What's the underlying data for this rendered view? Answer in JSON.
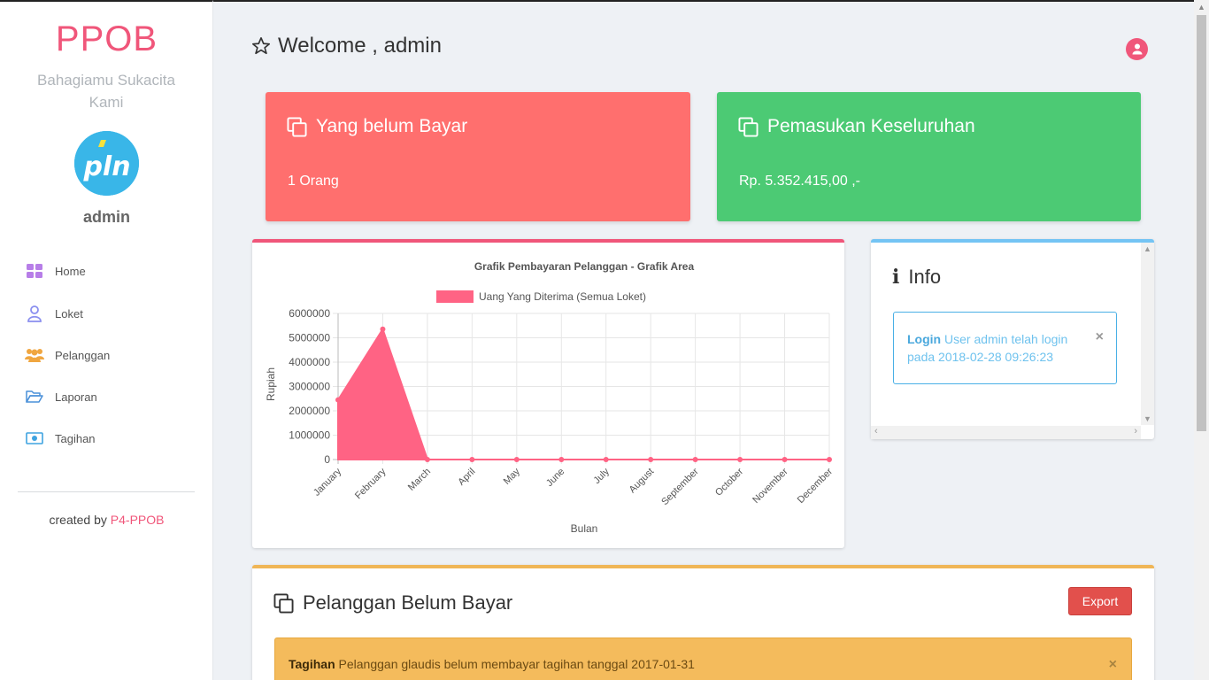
{
  "sidebar": {
    "brand": "PPOB",
    "tagline": "Bahagiamu Sukacita Kami",
    "logo_text": "pln",
    "username": "admin",
    "items": [
      {
        "label": "Home",
        "icon": "grid-icon",
        "color": "#b77ee8"
      },
      {
        "label": "Loket",
        "icon": "user-outline-icon",
        "color": "#8a8fef"
      },
      {
        "label": "Pelanggan",
        "icon": "users-icon",
        "color": "#f0a640"
      },
      {
        "label": "Laporan",
        "icon": "folder-open-icon",
        "color": "#4a90d9"
      },
      {
        "label": "Tagihan",
        "icon": "money-icon",
        "color": "#3fa3e0"
      }
    ],
    "credit_prefix": "created by ",
    "credit_link": "P4-PPOB"
  },
  "header": {
    "title": "Welcome , admin"
  },
  "stats": {
    "unpaid": {
      "title": "Yang belum Bayar",
      "value": "1 Orang"
    },
    "income": {
      "title": "Pemasukan Keseluruhan",
      "value": "Rp. 5.352.415,00 ,-"
    }
  },
  "colors": {
    "accent": "#f0567a",
    "red": "#ff6f6e",
    "green": "#4cca74",
    "info": "#74c4f4",
    "warning": "#f4bb5c"
  },
  "chart_data": {
    "type": "area",
    "title": "Grafik Pembayaran Pelanggan - Grafik Area",
    "legend": "Uang Yang Diterima (Semua Loket)",
    "legend_position": "top",
    "xlabel": "Bulan",
    "ylabel": "Rupiah",
    "categories": [
      "January",
      "February",
      "March",
      "April",
      "May",
      "June",
      "July",
      "August",
      "September",
      "October",
      "November",
      "December"
    ],
    "series": [
      {
        "name": "Uang Yang Diterima (Semua Loket)",
        "values": [
          2450000,
          5352415,
          0,
          0,
          0,
          0,
          0,
          0,
          0,
          0,
          0,
          0
        ]
      }
    ],
    "ylim": [
      0,
      6000000
    ],
    "yticks": [
      "6000000",
      "5000000",
      "4000000",
      "3000000",
      "2000000",
      "1000000",
      "0"
    ],
    "grid": true,
    "color": "#ff6384"
  },
  "info": {
    "title": "Info",
    "alert_bold": "Login",
    "alert_text": " User admin telah login pada 2018-02-28 09:26:23",
    "close": "×"
  },
  "unpaid_panel": {
    "title": "Pelanggan Belum Bayar",
    "export_label": "Export",
    "alert_bold": "Tagihan",
    "alert_text": " Pelanggan glaudis belum membayar tagihan tanggal 2017-01-31",
    "close": "×"
  }
}
